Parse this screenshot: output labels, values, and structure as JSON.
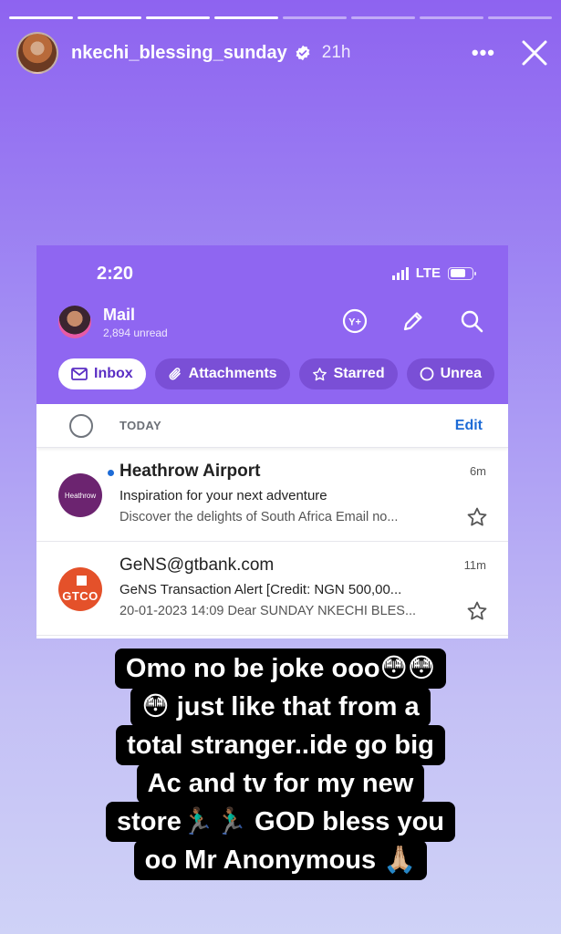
{
  "story": {
    "progress_total": 8,
    "progress_done": 4,
    "username": "nkechi_blessing_sunday",
    "verified": true,
    "time": "21h",
    "more_label": "•••"
  },
  "phone": {
    "status_time": "2:20",
    "network": "LTE"
  },
  "mail": {
    "title": "Mail",
    "unread_count": "2,894 unread",
    "tabs": [
      {
        "label": "Inbox",
        "icon": "envelope-icon",
        "active": true
      },
      {
        "label": "Attachments",
        "icon": "paperclip-icon"
      },
      {
        "label": "Starred",
        "icon": "star-icon"
      },
      {
        "label": "Unrea",
        "icon": "circle-icon"
      }
    ],
    "section_label": "TODAY",
    "edit_label": "Edit",
    "emails": [
      {
        "sender": "Heathrow Airport",
        "logo_text": "Heathrow",
        "unread": true,
        "time": "6m",
        "subject": "Inspiration for your next adventure",
        "preview": "Discover the delights of South Africa Email no..."
      },
      {
        "sender": "GeNS@gtbank.com",
        "logo_text": "GTCO",
        "unread": false,
        "time": "11m",
        "subject": "GeNS Transaction Alert [Credit: NGN 500,00...",
        "preview": "20-01-2023 14:09 Dear SUNDAY NKECHI BLES..."
      }
    ]
  },
  "caption": {
    "lines": [
      "Omo no be joke ooo😳😳",
      "😳 just like that from a",
      "total stranger..ide go big",
      "Ac and tv for my new",
      "store🏃🏾‍♂️🏃🏾‍♂️ GOD bless you",
      "oo Mr Anonymous 🙏🏼"
    ]
  },
  "colors": {
    "story_gradient_top": "#8e63f0",
    "mail_header": "#8f66f1",
    "tab_bg": "#7a4fd6",
    "link_blue": "#1d6bd6",
    "heathrow": "#6c2470",
    "gtco": "#e4512a"
  }
}
